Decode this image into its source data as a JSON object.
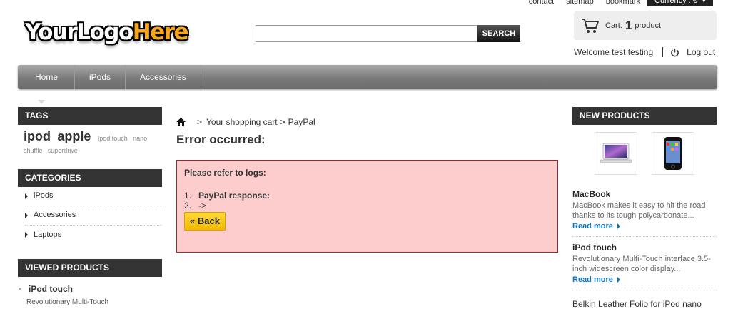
{
  "toplinks": {
    "contact": "contact",
    "sitemap": "sitemap",
    "bookmark": "bookmark",
    "currency": "Currency : €",
    "currency_arrow": "▾"
  },
  "logo": {
    "part1": "YourLogo",
    "part2": "Here"
  },
  "search": {
    "value": "",
    "button": "SEARCH"
  },
  "cart": {
    "label": "Cart:",
    "count": "1",
    "unit": "product"
  },
  "user": {
    "welcome": "Welcome test testing",
    "logout": "Log out"
  },
  "nav": {
    "items": [
      "Home",
      "iPods",
      "Accessories"
    ]
  },
  "tags": {
    "title": "TAGS",
    "big": [
      "ipod",
      "apple"
    ],
    "small": [
      "Ipod touch",
      "nano",
      "shuffle",
      "superdrive"
    ]
  },
  "categories": {
    "title": "CATEGORIES",
    "items": [
      "iPods",
      "Accessories",
      "Laptops"
    ]
  },
  "viewed": {
    "title": "VIEWED PRODUCTS",
    "item_title": "iPod touch",
    "item_desc": "Revolutionary Multi-Touch"
  },
  "breadcrumb": {
    "separator": ">",
    "item1": "Your shopping cart",
    "item2": "PayPal"
  },
  "main": {
    "heading": "Error occurred:",
    "error_title": "Please refer to logs:",
    "errors": [
      {
        "num": "1.",
        "text": "PayPal response:"
      },
      {
        "num": "2.",
        "text": "->"
      }
    ],
    "back": "« Back"
  },
  "new_products": {
    "title": "NEW PRODUCTS",
    "items": [
      {
        "name": "MacBook",
        "desc": "MacBook makes it easy to hit the road thanks to its tough polycarbonate...",
        "more": "Read more"
      },
      {
        "name": "iPod touch",
        "desc": "Revolutionary Multi-Touch interface 3.5-inch widescreen color display...",
        "more": "Read more"
      },
      {
        "name": "Belkin Leather Folio for iPod nano"
      }
    ]
  }
}
